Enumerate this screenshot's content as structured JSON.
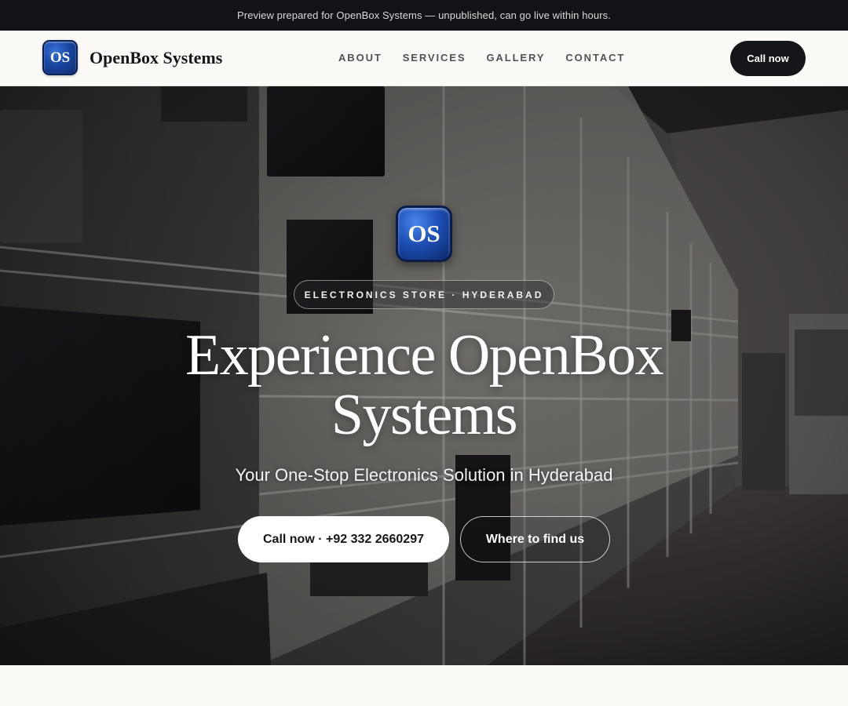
{
  "preview_bar": {
    "text": "Preview prepared for OpenBox Systems — unpublished, can go live within hours."
  },
  "header": {
    "logo_text": "OS",
    "brand_name": "OpenBox Systems",
    "nav": [
      {
        "label": "ABOUT"
      },
      {
        "label": "SERVICES"
      },
      {
        "label": "GALLERY"
      },
      {
        "label": "CONTACT"
      }
    ],
    "cta_label": "Call now"
  },
  "hero": {
    "logo_text": "OS",
    "eyebrow": "ELECTRONICS STORE · HYDERABAD",
    "title_line1": "Experience OpenBox",
    "title_line2": "Systems",
    "subtitle": "Your One-Stop Electronics Solution in Hyderabad",
    "primary_cta": "Call now · +92 332 2660297",
    "secondary_cta": "Where to find us",
    "background_icon": "electronics-showroom-photo"
  },
  "colors": {
    "preview_bar_bg": "#111317",
    "header_bg": "#fbfaf7",
    "cta_dark": "#15161a",
    "logo_blue": "#1d4fb5",
    "page_bg": "#faf9f6"
  }
}
